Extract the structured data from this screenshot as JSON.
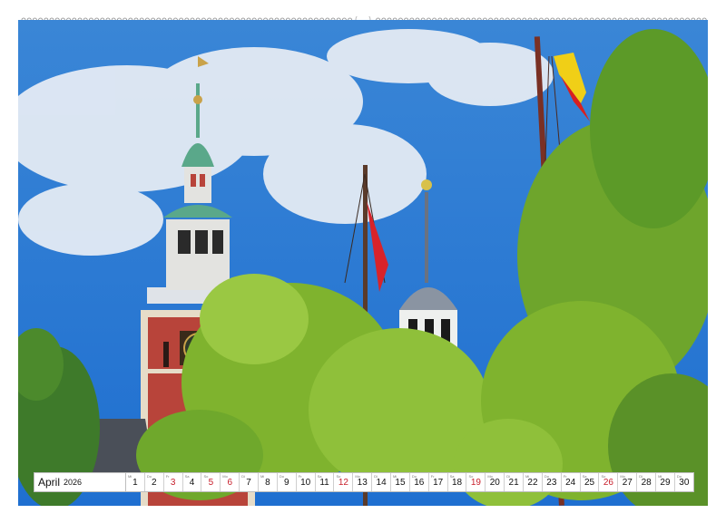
{
  "calendar": {
    "month": "April",
    "year": "2026",
    "days": [
      {
        "d": "1",
        "wd": "Mi",
        "red": false
      },
      {
        "d": "2",
        "wd": "Do",
        "red": false
      },
      {
        "d": "3",
        "wd": "Fr",
        "red": true
      },
      {
        "d": "4",
        "wd": "Sa",
        "red": false
      },
      {
        "d": "5",
        "wd": "So",
        "red": true
      },
      {
        "d": "6",
        "wd": "Mo",
        "red": true
      },
      {
        "d": "7",
        "wd": "Di",
        "red": false
      },
      {
        "d": "8",
        "wd": "Mi",
        "red": false
      },
      {
        "d": "9",
        "wd": "Do",
        "red": false
      },
      {
        "d": "10",
        "wd": "Fr",
        "red": false
      },
      {
        "d": "11",
        "wd": "Sa",
        "red": false
      },
      {
        "d": "12",
        "wd": "So",
        "red": true
      },
      {
        "d": "13",
        "wd": "Mo",
        "red": false
      },
      {
        "d": "14",
        "wd": "Di",
        "red": false
      },
      {
        "d": "15",
        "wd": "Mi",
        "red": false
      },
      {
        "d": "16",
        "wd": "Do",
        "red": false
      },
      {
        "d": "17",
        "wd": "Fr",
        "red": false
      },
      {
        "d": "18",
        "wd": "Sa",
        "red": false
      },
      {
        "d": "19",
        "wd": "So",
        "red": true
      },
      {
        "d": "20",
        "wd": "Mo",
        "red": false
      },
      {
        "d": "21",
        "wd": "Di",
        "red": false
      },
      {
        "d": "22",
        "wd": "Mi",
        "red": false
      },
      {
        "d": "23",
        "wd": "Do",
        "red": false
      },
      {
        "d": "24",
        "wd": "Fr",
        "red": false
      },
      {
        "d": "25",
        "wd": "Sa",
        "red": false
      },
      {
        "d": "26",
        "wd": "So",
        "red": true
      },
      {
        "d": "27",
        "wd": "Mo",
        "red": false
      },
      {
        "d": "28",
        "wd": "Di",
        "red": false
      },
      {
        "d": "29",
        "wd": "Mi",
        "red": false
      },
      {
        "d": "30",
        "wd": "Do",
        "red": false
      }
    ]
  },
  "colors": {
    "sky": "#2a7fd8",
    "brick": "#b8443a",
    "copper": "#5aa88a",
    "foliage": "#7fb32e",
    "holiday": "#c8202c"
  }
}
